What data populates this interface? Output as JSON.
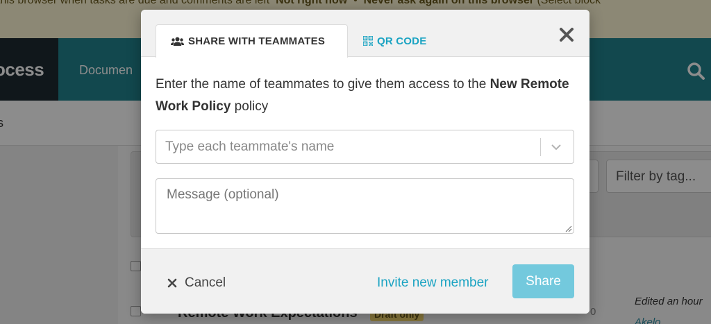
{
  "background": {
    "banner": {
      "text_before": "this browser when tasks are due and comments are left",
      "action_not_now": "Not right now",
      "separator": "•",
      "action_never": "Never ask again on this browser",
      "text_after": "(Select block"
    },
    "nav": {
      "logo": "ocess",
      "documents": "Documen"
    },
    "subbar_text": "s",
    "tag_filter_placeholder": "Filter by tag...",
    "row": {
      "title": "Remote Work Expectations",
      "badge": "Draft only",
      "counts": "0",
      "edited": "Edited an hour",
      "author": "Akelo"
    }
  },
  "modal": {
    "tabs": [
      {
        "label": "SHARE WITH TEAMMATES",
        "icon": "users-icon",
        "active": true
      },
      {
        "label": "QR CODE",
        "icon": "qr-code-icon",
        "active": false
      }
    ],
    "description": {
      "before": "Enter the name of teammates to give them access to the ",
      "policy_name": "New Remote Work Policy",
      "after": " policy"
    },
    "teammate_select": {
      "placeholder": "Type each teammate's name",
      "value": ""
    },
    "message": {
      "placeholder": "Message (optional)",
      "value": ""
    },
    "footer": {
      "cancel_label": "Cancel",
      "invite_label": "Invite new member",
      "share_label": "Share"
    }
  },
  "colors": {
    "accent": "#1aa3c2",
    "share_button": "#73c9dd",
    "navbar": "#21838e",
    "banner": "#fff8d5"
  }
}
